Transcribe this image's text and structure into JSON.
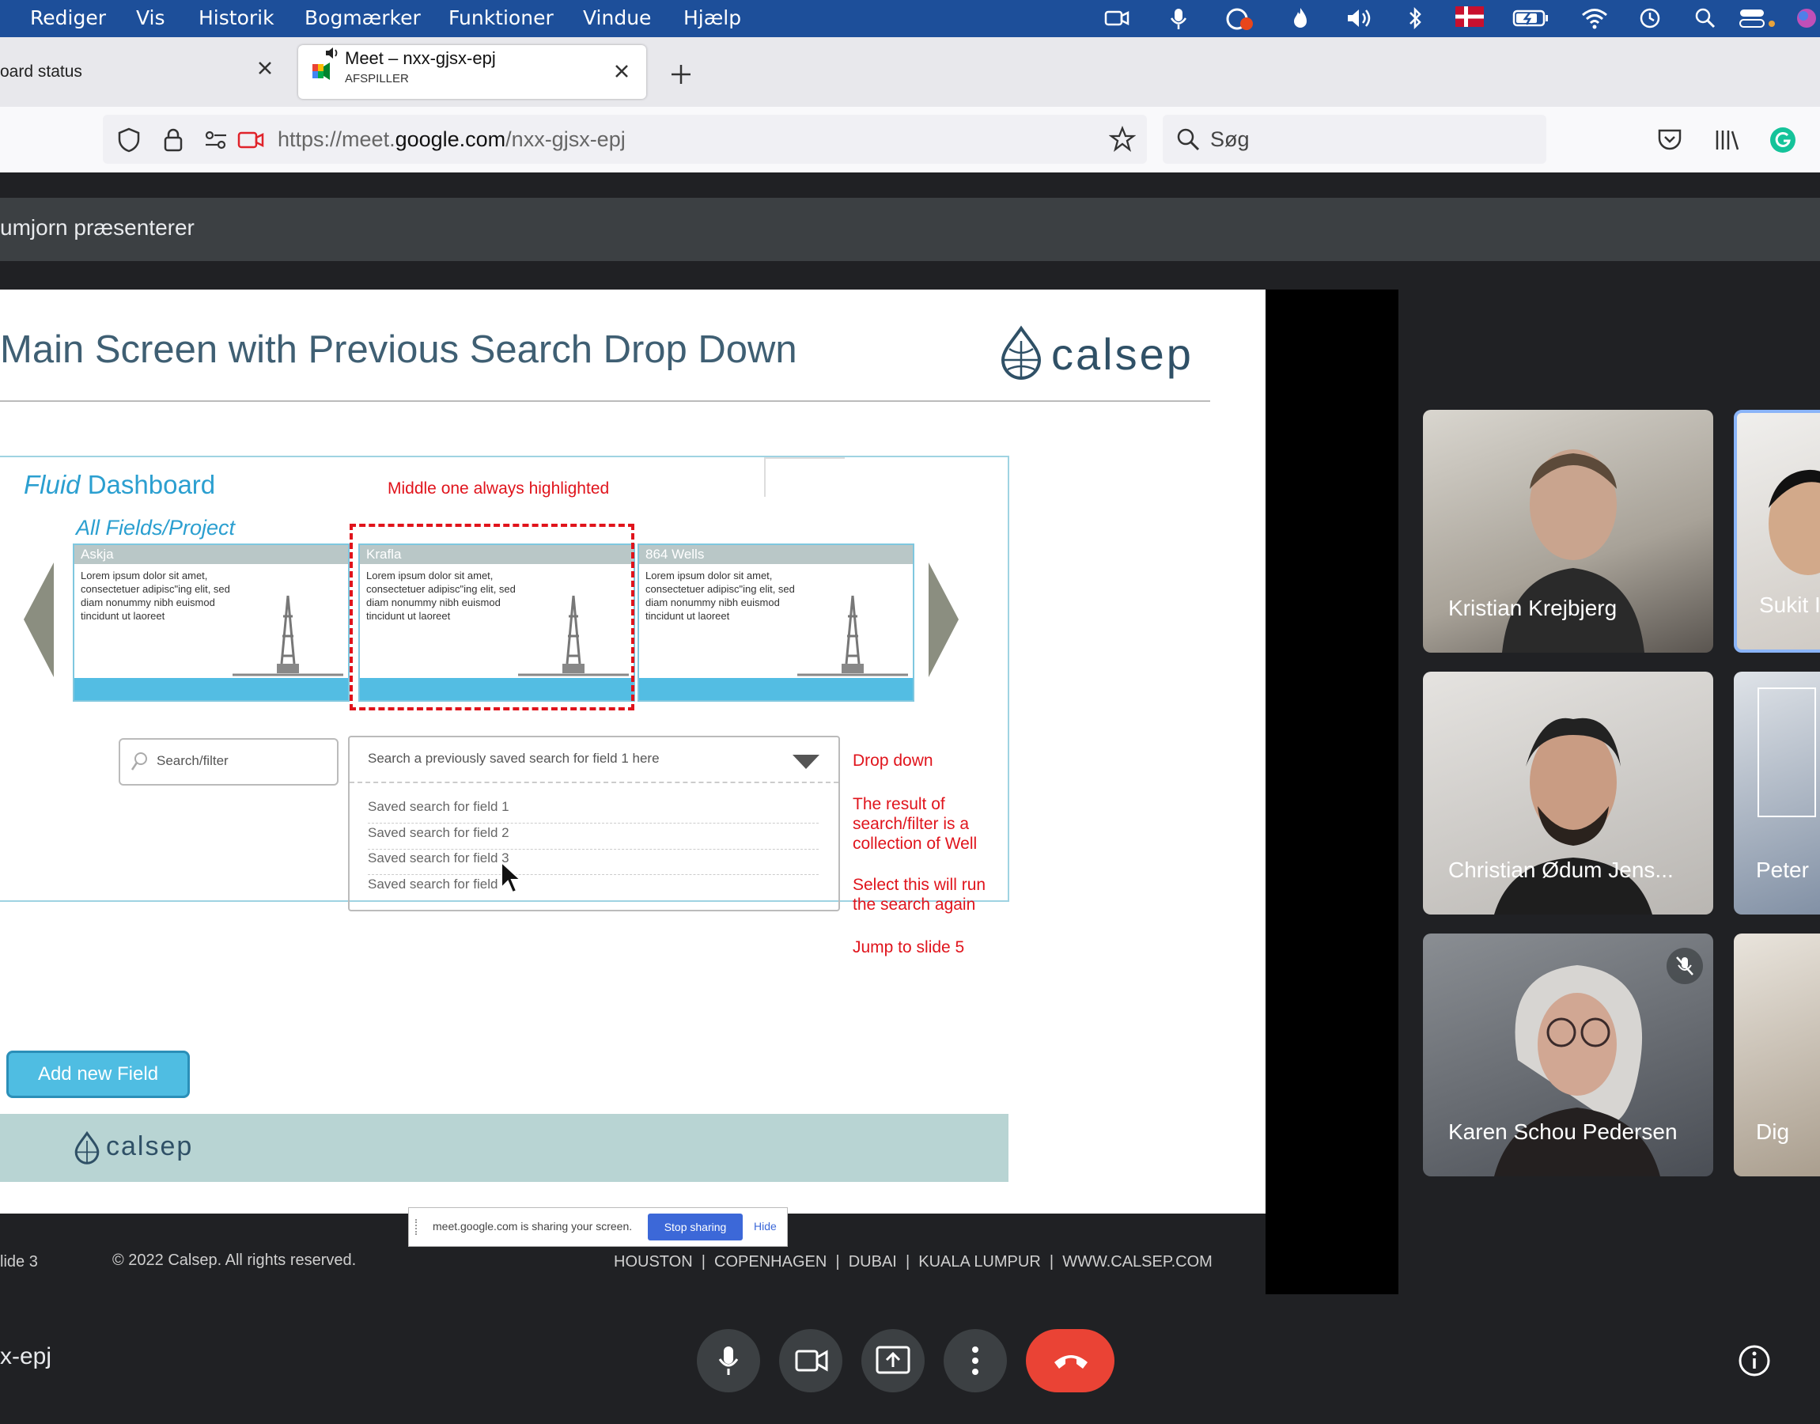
{
  "menubar": {
    "items": [
      "Rediger",
      "Vis",
      "Historik",
      "Bogmærker",
      "Funktioner",
      "Vindue",
      "Hjælp"
    ]
  },
  "tabs": {
    "tab1_title": "oard status",
    "tab2_title": "Meet – nxx-gjsx-epj",
    "tab2_subtitle": "AFSPILLER"
  },
  "url": {
    "prefix": "https://meet.",
    "domain": "google.com",
    "path": "/nxx-gjsx-epj"
  },
  "search": {
    "placeholder": "Søg"
  },
  "meet": {
    "presenting": "umjorn præsenterer",
    "meeting_code": "x-epj"
  },
  "slide": {
    "title": "Main Screen with Previous Search Drop Down",
    "logo_text": "calsep",
    "dashboard_italic": "Fluid",
    "dashboard_rest": " Dashboard",
    "fields_label": "All Fields/Project",
    "middle_note": "Middle one always highlighted",
    "cards": [
      {
        "name": "Askja",
        "text": "Lorem ipsum dolor sit amet, consectetuer adipisc\"ing elit, sed diam nonummy nibh euismod tincidunt ut laoreet"
      },
      {
        "name": "Krafla",
        "text": "Lorem ipsum dolor sit amet, consectetuer adipisc\"ing elit, sed diam nonummy nibh euismod tincidunt ut laoreet"
      },
      {
        "name": "864 Wells",
        "text": "Lorem ipsum dolor sit amet, consectetuer adipisc\"ing elit, sed diam nonummy nibh euismod tincidunt ut laoreet"
      }
    ],
    "search_placeholder": "Search/filter",
    "dropdown_header": "Search a previously saved search for field 1 here",
    "dropdown_items": [
      "Saved search for field 1",
      "Saved search for field 2",
      "Saved search for field 3",
      "Saved search for field"
    ],
    "notes": {
      "dropdown": "Drop down",
      "result": "The result of search/filter is a collection of Well",
      "select": "Select this will run the search again",
      "jump": "Jump to slide 5"
    },
    "add_button": "Add new Field",
    "footer_slide": "lide 3",
    "copyright": "© 2022 Calsep. All rights reserved.",
    "cities": "HOUSTON  |  COPENHAGEN  |  DUBAI  |  KUALA LUMPUR  |  WWW.CALSEP.COM"
  },
  "sharing": {
    "text": "meet.google.com is sharing your screen.",
    "stop": "Stop sharing",
    "hide": "Hide"
  },
  "participants": [
    {
      "name": "Kristian Krejbjerg"
    },
    {
      "name": "Sukit I"
    },
    {
      "name": "Christian Ødum Jens..."
    },
    {
      "name": "Peter"
    },
    {
      "name": "Karen Schou Pedersen"
    },
    {
      "name": "Dig"
    }
  ]
}
